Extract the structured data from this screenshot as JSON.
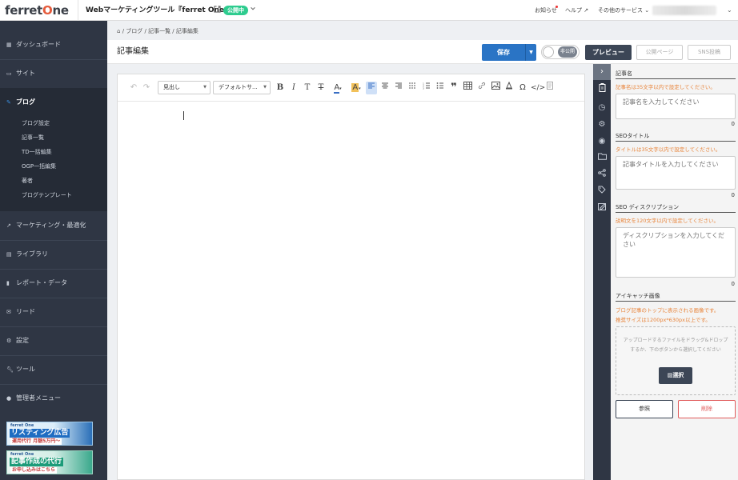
{
  "brand": {
    "logo_main": "ferret",
    "logo_o": "O",
    "logo_tail": "ne"
  },
  "site": {
    "title": "Webマーケティングツール『ferret One』",
    "status_badge": "公開中"
  },
  "top_nav": {
    "notice": "お知らせ",
    "help": "ヘルプ",
    "other_services": "その他のサービス"
  },
  "sidebar": {
    "items": [
      {
        "label": "ダッシュボード"
      },
      {
        "label": "サイト"
      },
      {
        "label": "ブログ"
      },
      {
        "label": "マーケティング・最適化"
      },
      {
        "label": "ライブラリ"
      },
      {
        "label": "レポート・データ"
      },
      {
        "label": "リード"
      },
      {
        "label": "設定"
      },
      {
        "label": "ツール"
      },
      {
        "label": "管理者メニュー"
      }
    ],
    "sub_items": [
      {
        "label": "ブログ設定"
      },
      {
        "label": "記事一覧"
      },
      {
        "label": "TD一括編集"
      },
      {
        "label": "OGP一括編集"
      },
      {
        "label": "著者"
      },
      {
        "label": "ブログテンプレート"
      }
    ],
    "banners": [
      {
        "brand": "ferret One",
        "main": "リスティング広告",
        "main2": "運用代行",
        "sub": "月額5万円〜"
      },
      {
        "brand": "ferret One",
        "main": "記事作成の代行",
        "sub": "お申し込みはこちら"
      }
    ]
  },
  "breadcrumb": {
    "home_icon": "home-icon",
    "text": "/ ブログ / 記事一覧 / 記事編集"
  },
  "page": {
    "title": "記事編集"
  },
  "actions": {
    "save": "保存",
    "toggle_label": "非公開",
    "preview": "プレビュー",
    "public_page": "公開ページ",
    "sns_post": "SNS投稿"
  },
  "editor": {
    "heading_select": "見出し",
    "font_select": "デフォルトサ..."
  },
  "panel": {
    "title_label": "記事名",
    "title_note": "記事名は35文字以内で設定してください。",
    "title_placeholder": "記事名を入力してください",
    "title_count": "0",
    "seo_title_label": "SEOタイトル",
    "seo_title_note": "タイトルは35文字以内で設定してください。",
    "seo_title_placeholder": "記事タイトルを入力してください",
    "seo_title_count": "0",
    "seo_desc_label": "SEO ディスクリプション",
    "seo_desc_note": "説明文を120文字以内で設定してください。",
    "seo_desc_placeholder": "ディスクリプションを入力してください",
    "seo_desc_count": "0",
    "eyecatch_label": "アイキャッチ画像",
    "eyecatch_note1": "ブログ記事のトップに表示される画像です。",
    "eyecatch_note2": "推奨サイズは1200px*630px以上です。",
    "dropzone_text": "アップロードするファイルをドラッグ&ドロップするか、下のボタンから選択してください",
    "select_button": "選択",
    "ref_button": "参照",
    "delete_button": "削除"
  },
  "colors": {
    "accent": "#2a74c5",
    "sidebar_bg": "#2f3644",
    "badge_green": "#2ecc8f",
    "note_orange": "#e8843a",
    "danger": "#e05a5a"
  }
}
